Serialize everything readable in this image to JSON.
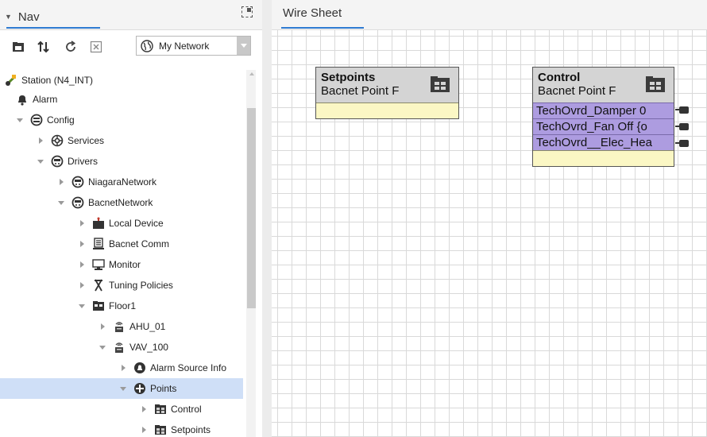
{
  "nav": {
    "tab_label": "Nav",
    "network_select": {
      "selected": "My Network"
    },
    "tree": [
      {
        "label": "Station (N4_INT)",
        "icon": "station-icon",
        "expander": "none",
        "selected": false
      },
      {
        "label": "Alarm",
        "icon": "bell-icon",
        "expander": "none",
        "selected": false
      },
      {
        "label": "Config",
        "icon": "config-icon",
        "expander": "down",
        "selected": false
      },
      {
        "label": "Services",
        "icon": "services-icon",
        "expander": "right",
        "selected": false
      },
      {
        "label": "Drivers",
        "icon": "drivers-icon",
        "expander": "down",
        "selected": false
      },
      {
        "label": "NiagaraNetwork",
        "icon": "network-icon",
        "expander": "right",
        "selected": false
      },
      {
        "label": "BacnetNetwork",
        "icon": "network-icon",
        "expander": "down",
        "selected": false
      },
      {
        "label": "Local Device",
        "icon": "device-icon",
        "expander": "right",
        "selected": false
      },
      {
        "label": "Bacnet Comm",
        "icon": "comm-icon",
        "expander": "right",
        "selected": false
      },
      {
        "label": "Monitor",
        "icon": "monitor-icon",
        "expander": "right",
        "selected": false
      },
      {
        "label": "Tuning Policies",
        "icon": "tuning-icon",
        "expander": "right",
        "selected": false
      },
      {
        "label": "Floor1",
        "icon": "folder-icon",
        "expander": "down",
        "selected": false
      },
      {
        "label": "AHU_01",
        "icon": "controller-icon",
        "expander": "right",
        "selected": false
      },
      {
        "label": "VAV_100",
        "icon": "controller-icon",
        "expander": "down",
        "selected": false
      },
      {
        "label": "Alarm Source Info",
        "icon": "alarm-source-icon",
        "expander": "right",
        "selected": false
      },
      {
        "label": "Points",
        "icon": "points-icon",
        "expander": "down",
        "selected": true
      },
      {
        "label": "Control",
        "icon": "folder-grid-icon",
        "expander": "right",
        "selected": false
      },
      {
        "label": "Setpoints",
        "icon": "folder-grid-icon",
        "expander": "right",
        "selected": false
      }
    ]
  },
  "wiresheet": {
    "tab_label": "Wire Sheet",
    "blocks": [
      {
        "id": "setpoints",
        "title": "Setpoints",
        "type": "Bacnet Point F",
        "slots": []
      },
      {
        "id": "control",
        "title": "Control",
        "type": "Bacnet Point F",
        "slots": [
          "TechOvrd_Damper 0",
          "TechOvrd_Fan Off {o",
          "TechOvrd__Elec_Hea"
        ]
      }
    ]
  },
  "colors": {
    "accent": "#2f7bd1",
    "selection": "#cfdff7",
    "slot": "#ad9ce0",
    "block_body": "#fbf7c4"
  }
}
